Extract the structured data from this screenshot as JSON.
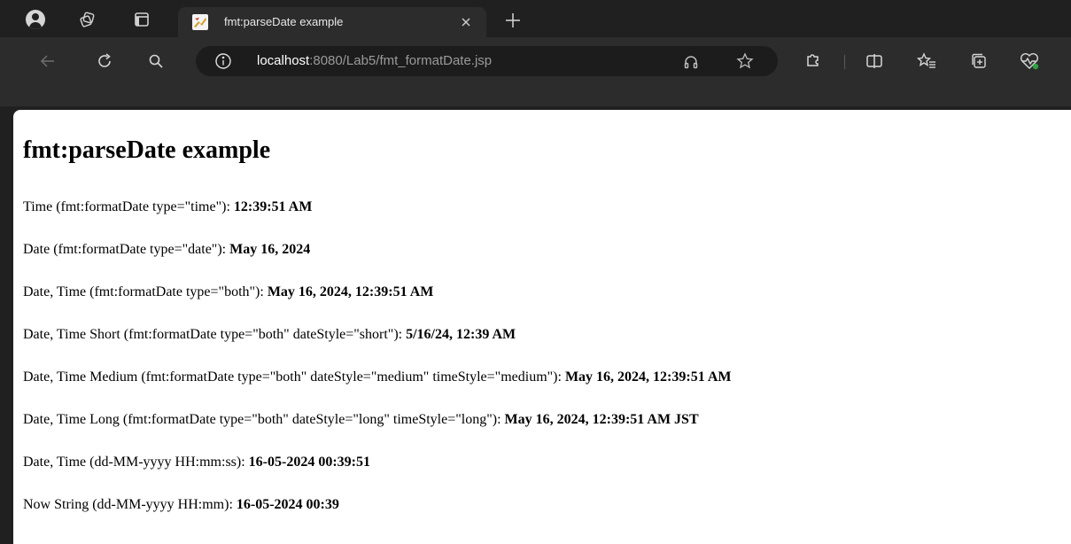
{
  "tab": {
    "title": "fmt:parseDate example",
    "close_glyph": "×",
    "new_tab_glyph": "+"
  },
  "address": {
    "host": "localhost",
    "rest": ":8080/Lab5/fmt_formatDate.jsp"
  },
  "icons": {
    "profile": "profile-icon",
    "workspaces": "workspaces-icon",
    "tab_actions": "tab-actions-icon",
    "back": "back-arrow-icon",
    "refresh": "refresh-icon",
    "search": "search-icon",
    "info": "site-info-icon",
    "read_aloud": "read-aloud-icon",
    "favorite": "star-icon",
    "extensions": "extensions-icon",
    "split_screen": "split-screen-icon",
    "favorites": "favorites-icon",
    "collections": "collections-icon",
    "health": "browser-essentials-icon"
  },
  "colors": {
    "chrome_dark": "#202020",
    "toolbar": "#2c2c2c",
    "address_bg": "#1c1c1c",
    "page_bg": "#ffffff",
    "health_dot": "#2ea043"
  },
  "page": {
    "heading": "fmt:parseDate example",
    "lines": [
      {
        "label": "Time (fmt:formatDate type=\"time\"): ",
        "value": "12:39:51 AM"
      },
      {
        "label": "Date (fmt:formatDate type=\"date\"): ",
        "value": "May 16, 2024"
      },
      {
        "label": "Date, Time (fmt:formatDate type=\"both\"): ",
        "value": "May 16, 2024, 12:39:51 AM"
      },
      {
        "label": "Date, Time Short (fmt:formatDate type=\"both\" dateStyle=\"short\"): ",
        "value": "5/16/24, 12:39 AM"
      },
      {
        "label": "Date, Time Medium (fmt:formatDate type=\"both\" dateStyle=\"medium\" timeStyle=\"medium\"): ",
        "value": "May 16, 2024, 12:39:51 AM"
      },
      {
        "label": "Date, Time Long (fmt:formatDate type=\"both\" dateStyle=\"long\" timeStyle=\"long\"): ",
        "value": "May 16, 2024, 12:39:51 AM JST"
      },
      {
        "label": "Date, Time (dd-MM-yyyy HH:mm:ss): ",
        "value": "16-05-2024 00:39:51"
      },
      {
        "label": "Now String (dd-MM-yyyy HH:mm): ",
        "value": "16-05-2024 00:39"
      }
    ]
  }
}
